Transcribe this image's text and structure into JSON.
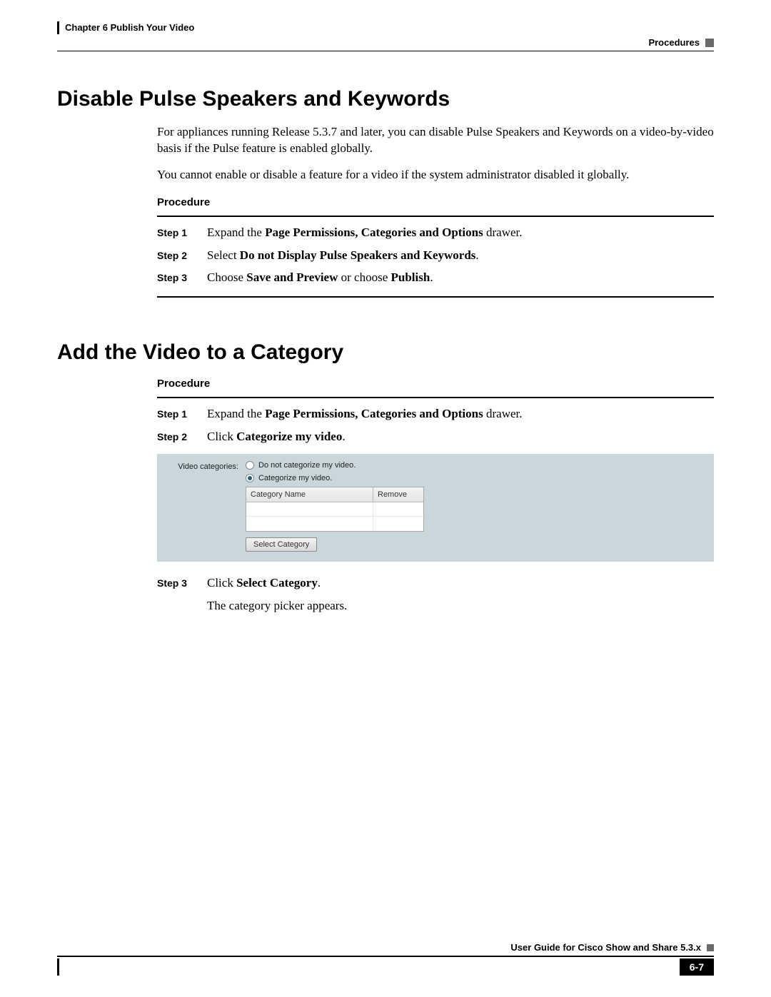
{
  "header": {
    "chapter": "Chapter 6      Publish Your Video",
    "section": "Procedures"
  },
  "section1": {
    "title": "Disable Pulse Speakers and Keywords",
    "para1": "For appliances running Release 5.3.7 and later, you can disable Pulse Speakers and Keywords on a video-by-video basis if the Pulse feature is enabled globally.",
    "para2": "You cannot enable or disable a feature for a video if the system administrator disabled it globally.",
    "procedure": "Procedure",
    "steps": {
      "s1": {
        "label": "Step 1",
        "pre": "Expand the ",
        "bold": "Page Permissions, Categories and Options",
        "post": " drawer."
      },
      "s2": {
        "label": "Step 2",
        "pre": "Select ",
        "bold": "Do not Display Pulse Speakers and Keywords",
        "post": "."
      },
      "s3": {
        "label": "Step 3",
        "pre": "Choose ",
        "bold1": "Save and Preview",
        "mid": " or choose ",
        "bold2": "Publish",
        "post": "."
      }
    }
  },
  "section2": {
    "title": "Add the Video to a Category",
    "procedure": "Procedure",
    "steps": {
      "s1": {
        "label": "Step 1",
        "pre": "Expand the ",
        "bold": "Page Permissions, Categories and Options",
        "post": " drawer."
      },
      "s2": {
        "label": "Step 2",
        "pre": "Click ",
        "bold": "Categorize my video",
        "post": "."
      },
      "s3": {
        "label": "Step 3",
        "pre": "Click ",
        "bold": "Select Category",
        "post": "."
      },
      "after3": "The category picker appears."
    }
  },
  "figure": {
    "label": "Video categories:",
    "radio1": "Do not categorize my video.",
    "radio2": "Categorize my video.",
    "col1": "Category Name",
    "col2": "Remove",
    "button": "Select Category"
  },
  "footer": {
    "guide": "User Guide for Cisco Show and Share 5.3.x",
    "page": "6-7"
  }
}
